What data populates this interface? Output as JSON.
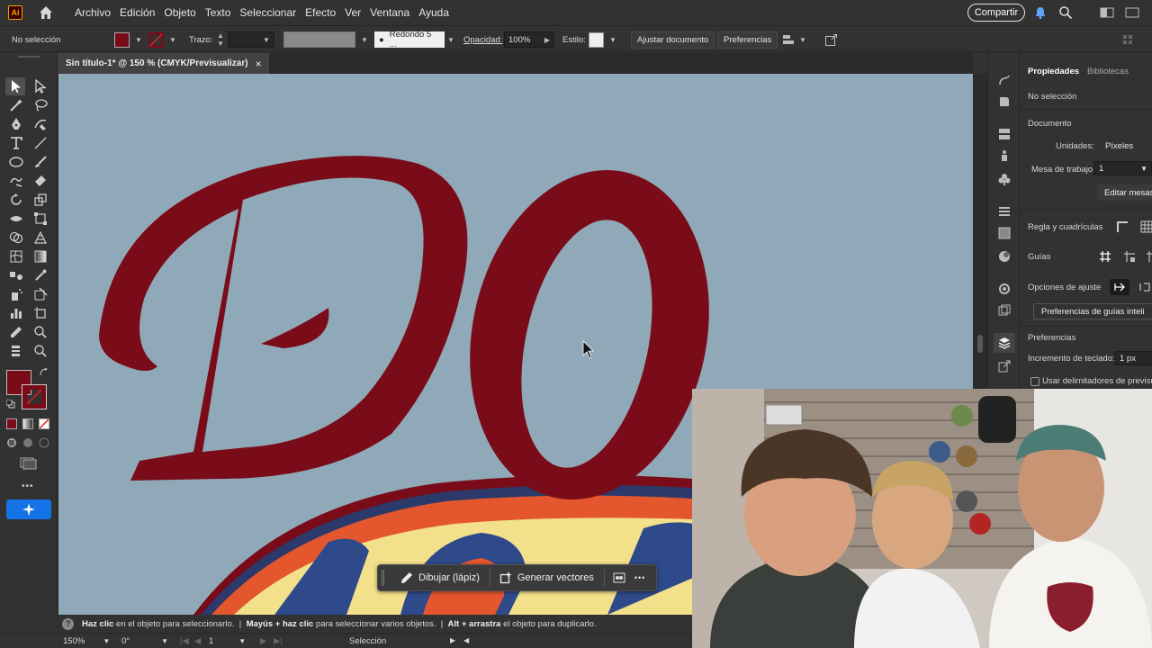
{
  "app": {
    "logo_text": "Ai",
    "share_label": "Compartir"
  },
  "menu": [
    "Archivo",
    "Edición",
    "Objeto",
    "Texto",
    "Seleccionar",
    "Efecto",
    "Ver",
    "Ventana",
    "Ayuda"
  ],
  "control_bar": {
    "selection_state": "No selección",
    "stroke_label": "Trazo:",
    "brush_value": "Redondo 5 ...",
    "opacity_label": "Opacidad:",
    "opacity_value": "100%",
    "style_label": "Estilo:",
    "fit_document_label": "Ajustar documento",
    "preferences_label": "Preferencias",
    "fill_color": "#7a0c19"
  },
  "document": {
    "tab_title": "Sin título-1* @ 150 % (CMYK/Previsualizar)",
    "close_glyph": "×"
  },
  "canvas": {
    "background_color": "#90a9b8",
    "lettering_color": "#7a0c19"
  },
  "properties_panel": {
    "tab_properties": "Propiedades",
    "tab_libraries": "Bibliotecas",
    "no_selection": "No selección",
    "document_heading": "Documento",
    "units_label": "Unidades:",
    "units_value": "Píxeles",
    "artboard_label": "Mesa de trabajo:",
    "artboard_value": "1",
    "edit_artboards_label": "Editar mesas",
    "rulers_grid_label": "Regla y cuadrículas",
    "guides_label": "Guías",
    "snap_options_label": "Opciones de ajuste",
    "smart_guides_prefs_label": "Preferencias de guías inteli",
    "preferences_heading": "Preferencias",
    "keyboard_increment_label": "Incremento de teclado:",
    "keyboard_increment_value": "1 px",
    "preview_bounds_label": "Usar delimitadores de previsuali"
  },
  "task_bar": {
    "draw_pencil_label": "Dibujar (lápiz)",
    "generate_vectors_label": "Generar vectores",
    "more_glyph": "•••"
  },
  "hint_bar": {
    "part1_bold": "Haz clic",
    "part1": " en el objeto para seleccionarlo.  |  ",
    "part2_bold": "Mayús + haz clic",
    "part2": " para seleccionar varios objetos.  |  ",
    "part3_bold": "Alt + arrastra",
    "part3": " el objeto para duplicarlo."
  },
  "status_bar": {
    "zoom_value": "150%",
    "rotation_value": "0°",
    "artboard_nav_value": "1",
    "mode_label": "Selección"
  },
  "toolbar": {
    "fill_color": "#7a0c19",
    "more_glyph": "•••"
  }
}
